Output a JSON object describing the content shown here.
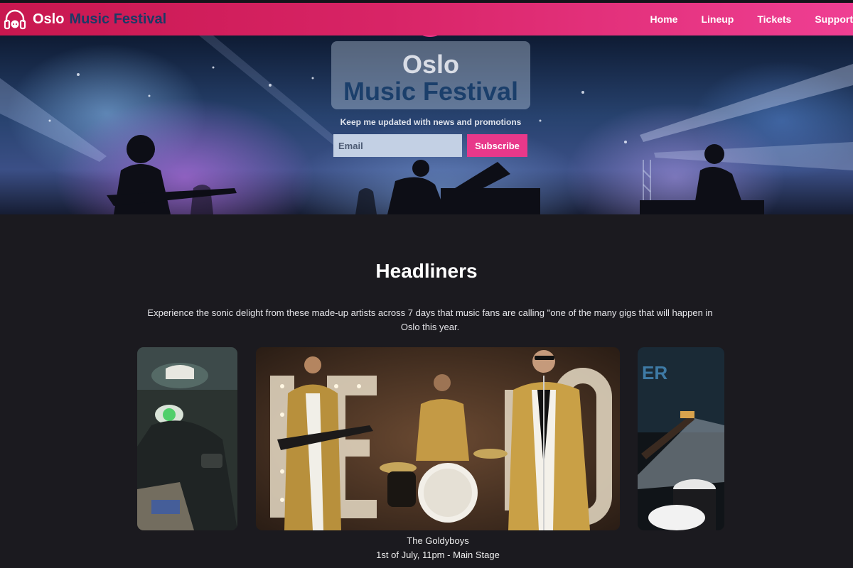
{
  "brand": {
    "name_part1": "Oslo",
    "name_part2": "Music Festival",
    "logo_icon": "headphones-icon"
  },
  "nav": {
    "items": [
      {
        "label": "Home"
      },
      {
        "label": "Lineup"
      },
      {
        "label": "Tickets"
      },
      {
        "label": "Support"
      }
    ]
  },
  "hero": {
    "title_line1": "Oslo",
    "title_line2": "Music Festival",
    "promo_text": "Keep me updated with news and promotions",
    "email_placeholder": "Email",
    "subscribe_label": "Subscribe"
  },
  "headliners": {
    "title": "Headliners",
    "description": "Experience the sonic delight from these made-up artists across 7 days that music fans are calling \"one of the many gigs that will happen in Oslo this year.",
    "current": {
      "name": "The Goldyboys",
      "details": "1st of July, 11pm - Main Stage"
    }
  },
  "colors": {
    "nav_start": "#c8174f",
    "nav_end": "#ef3f93",
    "brand_dark": "#1b3a66",
    "accent": "#e8388a",
    "page_bg": "#1b1a1f"
  }
}
